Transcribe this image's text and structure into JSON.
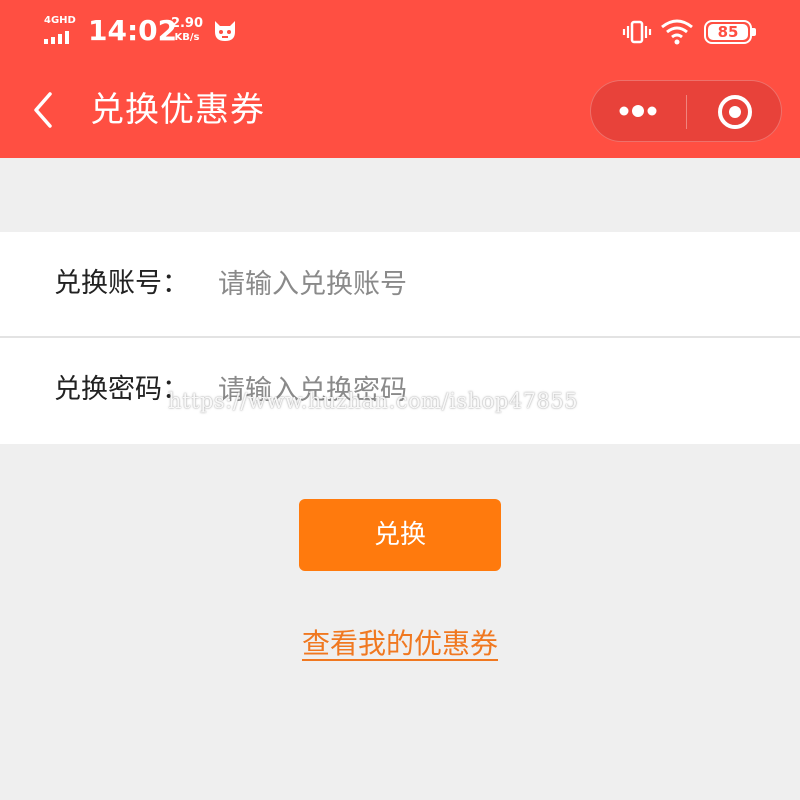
{
  "status_bar": {
    "network": "4GHD",
    "time": "14:02",
    "speed_value": "2.90",
    "speed_unit": "KB/s",
    "battery": "85",
    "icons": [
      "signal-icon",
      "mascot-icon",
      "vibrate-icon",
      "wifi-icon",
      "battery-icon"
    ]
  },
  "nav": {
    "back_icon": "chevron-left-icon",
    "title": "兑换优惠券",
    "more_icon": "more-dots-icon",
    "close_icon": "target-circle-icon"
  },
  "form": {
    "account_label": "兑换账号：",
    "account_placeholder": "请输入兑换账号",
    "password_label": "兑换密码：",
    "password_placeholder": "请输入兑换密码"
  },
  "submit_label": "兑换",
  "view_coupons_link": "查看我的优惠券",
  "watermark": "https://www.huzhan.com/ishop47855",
  "colors": {
    "header_bg": "#ff4f42",
    "button_bg": "#ff7a0d",
    "link_color": "#f07820",
    "page_bg": "#efefef"
  }
}
